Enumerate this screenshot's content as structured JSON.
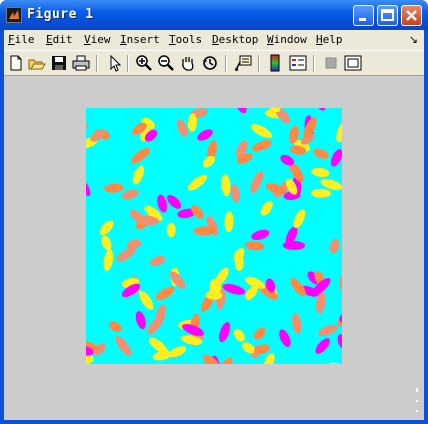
{
  "window": {
    "title": "Figure 1",
    "title_icon": "matlab-logo-icon"
  },
  "title_buttons": [
    "minimize",
    "maximize",
    "close"
  ],
  "menu": {
    "items": [
      {
        "label": "File",
        "mnemonic": "F",
        "rest": "ile"
      },
      {
        "label": "Edit",
        "mnemonic": "E",
        "rest": "dit"
      },
      {
        "label": "View",
        "mnemonic": "V",
        "rest": "iew"
      },
      {
        "label": "Insert",
        "mnemonic": "I",
        "rest": "nsert"
      },
      {
        "label": "Tools",
        "mnemonic": "T",
        "rest": "ools"
      },
      {
        "label": "Desktop",
        "mnemonic": "D",
        "rest": "esktop"
      },
      {
        "label": "Window",
        "mnemonic": "W",
        "rest": "indow"
      },
      {
        "label": "Help",
        "mnemonic": "H",
        "rest": "elp"
      }
    ],
    "dock_glyph": "↘"
  },
  "toolbar": {
    "tools": [
      "new-figure",
      "open-file",
      "save",
      "print",
      "edit-plot-arrow",
      "zoom-in",
      "zoom-out",
      "pan-hand",
      "rotate-3d",
      "data-cursor",
      "colorbar",
      "legend",
      "hide-plot-tools",
      "show-plot-tools"
    ]
  },
  "figure": {
    "background": "#cccccc",
    "axes_background": "#00ffff",
    "palette": [
      "#ff00ff",
      "#ffee22",
      "#f09070",
      "#ff8844"
    ]
  }
}
